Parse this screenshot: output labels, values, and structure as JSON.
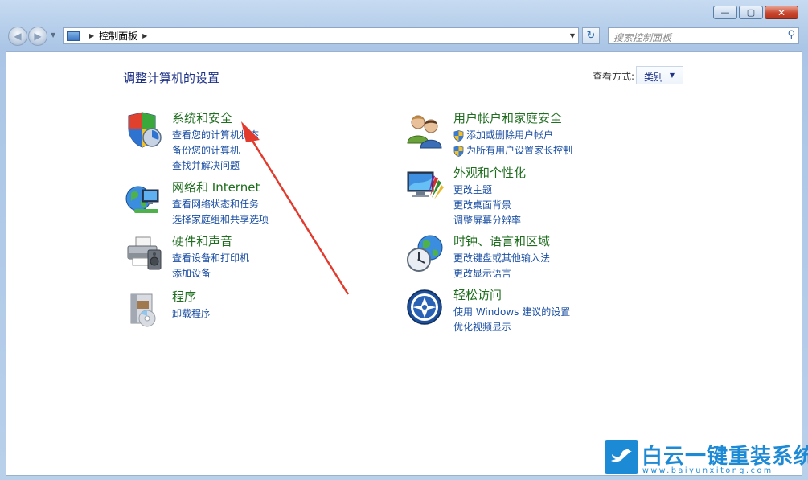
{
  "window": {
    "minimize_glyph": "—",
    "maximize_glyph": "▢",
    "close_glyph": "✕"
  },
  "navbar": {
    "back_glyph": "◀",
    "forward_glyph": "▶",
    "breadcrumb": "控制面板",
    "separator": "▶",
    "dropdown_glyph": "▼",
    "refresh_glyph": "↻",
    "search_placeholder": "搜索控制面板",
    "search_glyph": "⚲"
  },
  "main": {
    "title": "调整计算机的设置",
    "view_by_label": "查看方式:",
    "view_by_value": "类别",
    "caret": "▼"
  },
  "categories": [
    {
      "title": "系统和安全",
      "icon": "system-security-icon",
      "links": [
        "查看您的计算机状态",
        "备份您的计算机",
        "查找并解决问题"
      ]
    },
    {
      "title": "网络和 Internet",
      "icon": "network-globe-icon",
      "links": [
        "查看网络状态和任务",
        "选择家庭组和共享选项"
      ]
    },
    {
      "title": "硬件和声音",
      "icon": "printer-icon",
      "links": [
        "查看设备和打印机",
        "添加设备"
      ]
    },
    {
      "title": "程序",
      "icon": "programs-box-icon",
      "links": [
        "卸载程序"
      ]
    },
    {
      "title": "用户帐户和家庭安全",
      "icon": "users-icon",
      "links": [
        "添加或删除用户帐户",
        "为所有用户设置家长控制"
      ]
    },
    {
      "title": "外观和个性化",
      "icon": "appearance-monitor-icon",
      "links": [
        "更改主题",
        "更改桌面背景",
        "调整屏幕分辨率"
      ]
    },
    {
      "title": "时钟、语言和区域",
      "icon": "clock-globe-icon",
      "links": [
        "更改键盘或其他输入法",
        "更改显示语言"
      ]
    },
    {
      "title": "轻松访问",
      "icon": "ease-of-access-icon",
      "links": [
        "使用 Windows 建议的设置",
        "优化视频显示"
      ]
    }
  ],
  "watermark": {
    "name": "白云一键重装系统",
    "url": "www.baiyunxitong.com",
    "icon": "bird-logo-icon"
  },
  "annotation": {
    "color": "#e23b2e"
  }
}
